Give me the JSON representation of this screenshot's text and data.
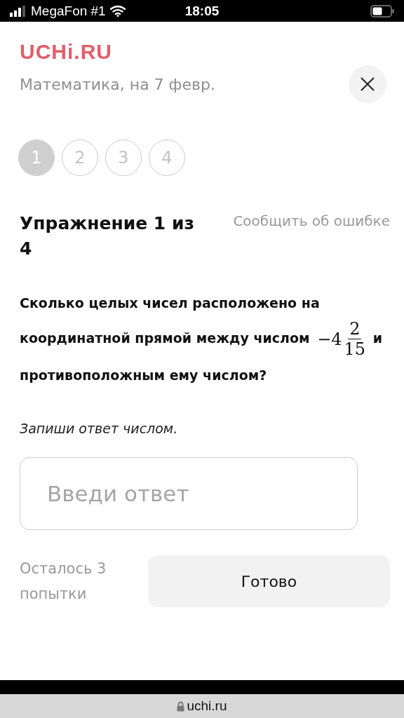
{
  "status_bar": {
    "carrier": "MegaFon #1",
    "time": "18:05"
  },
  "header": {
    "logo": "UCHi.RU",
    "subtitle": "Математика, на 7 февр."
  },
  "steps": [
    {
      "label": "1",
      "selected": true
    },
    {
      "label": "2",
      "selected": false
    },
    {
      "label": "3",
      "selected": false
    },
    {
      "label": "4",
      "selected": false
    }
  ],
  "exercise": {
    "title": "Упражнение 1 из 4",
    "report_link": "Сообщить об ошибке"
  },
  "question": {
    "before": "Сколько целых чисел расположено на координатной прямой между числом",
    "math": {
      "whole": "−4",
      "numerator": "2",
      "denominator": "15"
    },
    "after": "и противоположным ему числом?"
  },
  "instruction": "Запиши ответ числом.",
  "answer": {
    "placeholder": "Введи ответ"
  },
  "attempts": "Осталось 3 попытки",
  "submit_button": "Готово",
  "browser": {
    "url": "uchi.ru"
  }
}
